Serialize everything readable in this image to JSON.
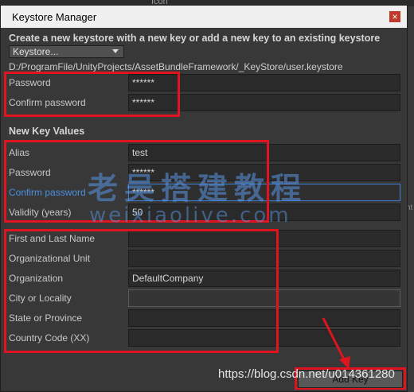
{
  "background": {
    "ghost_label": "Icon",
    "side_label": "nt"
  },
  "window": {
    "title": "Keystore Manager",
    "close_glyph": "×"
  },
  "header": {
    "instruction": "Create a new keystore with a new key or add a new key to an existing keystore",
    "dropdown_value": "Keystore...",
    "path": "D:/ProgramFile/UnityProjects/AssetBundleFramework/_KeyStore/user.keystore"
  },
  "keystore_password": {
    "password_label": "Password",
    "password_value": "******",
    "confirm_label": "Confirm password",
    "confirm_value": "******"
  },
  "new_key": {
    "section_title": "New Key Values",
    "alias_label": "Alias",
    "alias_value": "test",
    "password_label": "Password",
    "password_value": "******",
    "confirm_label": "Confirm password",
    "confirm_value": "******",
    "validity_label": "Validity (years)",
    "validity_value": "50"
  },
  "identity": {
    "name_label": "First and Last Name",
    "name_value": "",
    "unit_label": "Organizational Unit",
    "unit_value": "",
    "org_label": "Organization",
    "org_value": "DefaultCompany",
    "city_label": "City or Locality",
    "city_value": "",
    "state_label": "State or Province",
    "state_value": "",
    "country_label": "Country Code (XX)",
    "country_value": ""
  },
  "footer": {
    "add_key_label": "Add Key"
  },
  "watermark": {
    "chinese": "老吴搭建教程",
    "latin": "weixiaolive.com"
  },
  "credit": "https://blog.csdn.net/u014361280",
  "colors": {
    "highlight_box": "#e0141e",
    "focus_blue": "#4a90e2"
  }
}
